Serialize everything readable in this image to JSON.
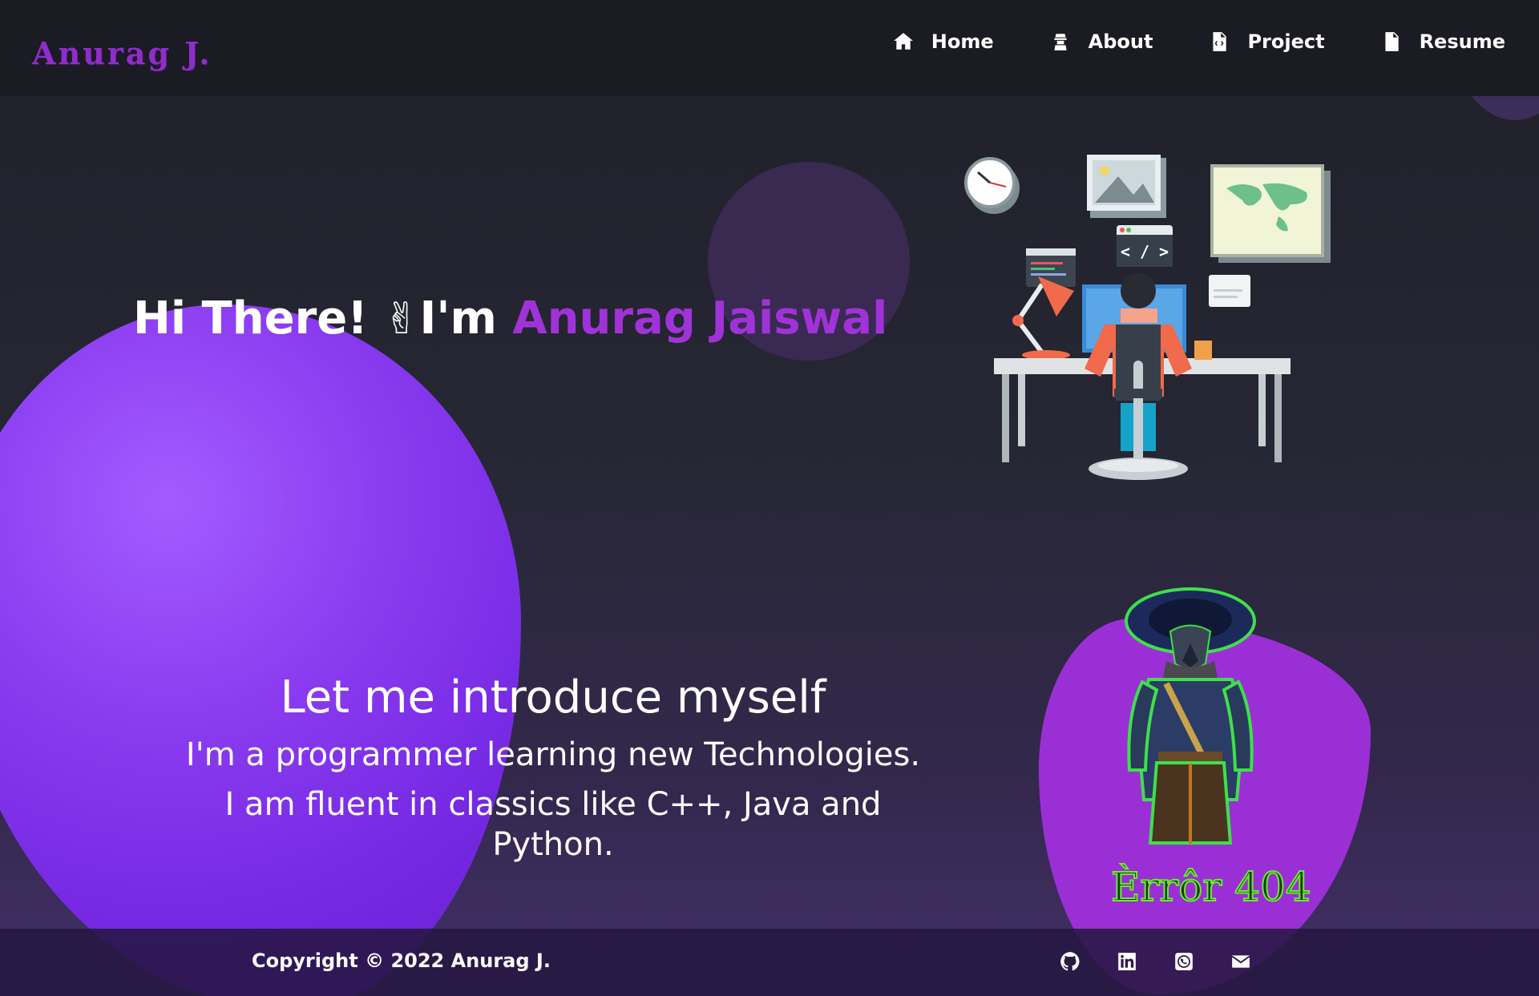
{
  "brand": {
    "logo_text": "Anurag J."
  },
  "nav": {
    "items": [
      {
        "label": "Home",
        "icon": "home-icon"
      },
      {
        "label": "About",
        "icon": "user-icon"
      },
      {
        "label": "Project",
        "icon": "file-code-icon"
      },
      {
        "label": "Resume",
        "icon": "file-icon"
      }
    ]
  },
  "hero": {
    "greeting": "Hi There! ",
    "wave_emoji": "✌",
    "intro_prefix": "I'm ",
    "name": "Anurag Jaiswal"
  },
  "intro": {
    "heading": "Let me introduce myself",
    "line1": "I'm a programmer learning new Technologies.",
    "line2": "I am fluent in classics like C++, Java and Python."
  },
  "avatar": {
    "label": "Èrrôr 404"
  },
  "footer": {
    "copyright": "Copyright © 2022 Anurag J.",
    "socials": [
      "github-icon",
      "linkedin-icon",
      "whatsapp-icon",
      "mail-icon"
    ]
  },
  "colors": {
    "accent": "#a033d8",
    "navbar_bg": "#1a1b23",
    "blob": "#7a2fe6"
  }
}
